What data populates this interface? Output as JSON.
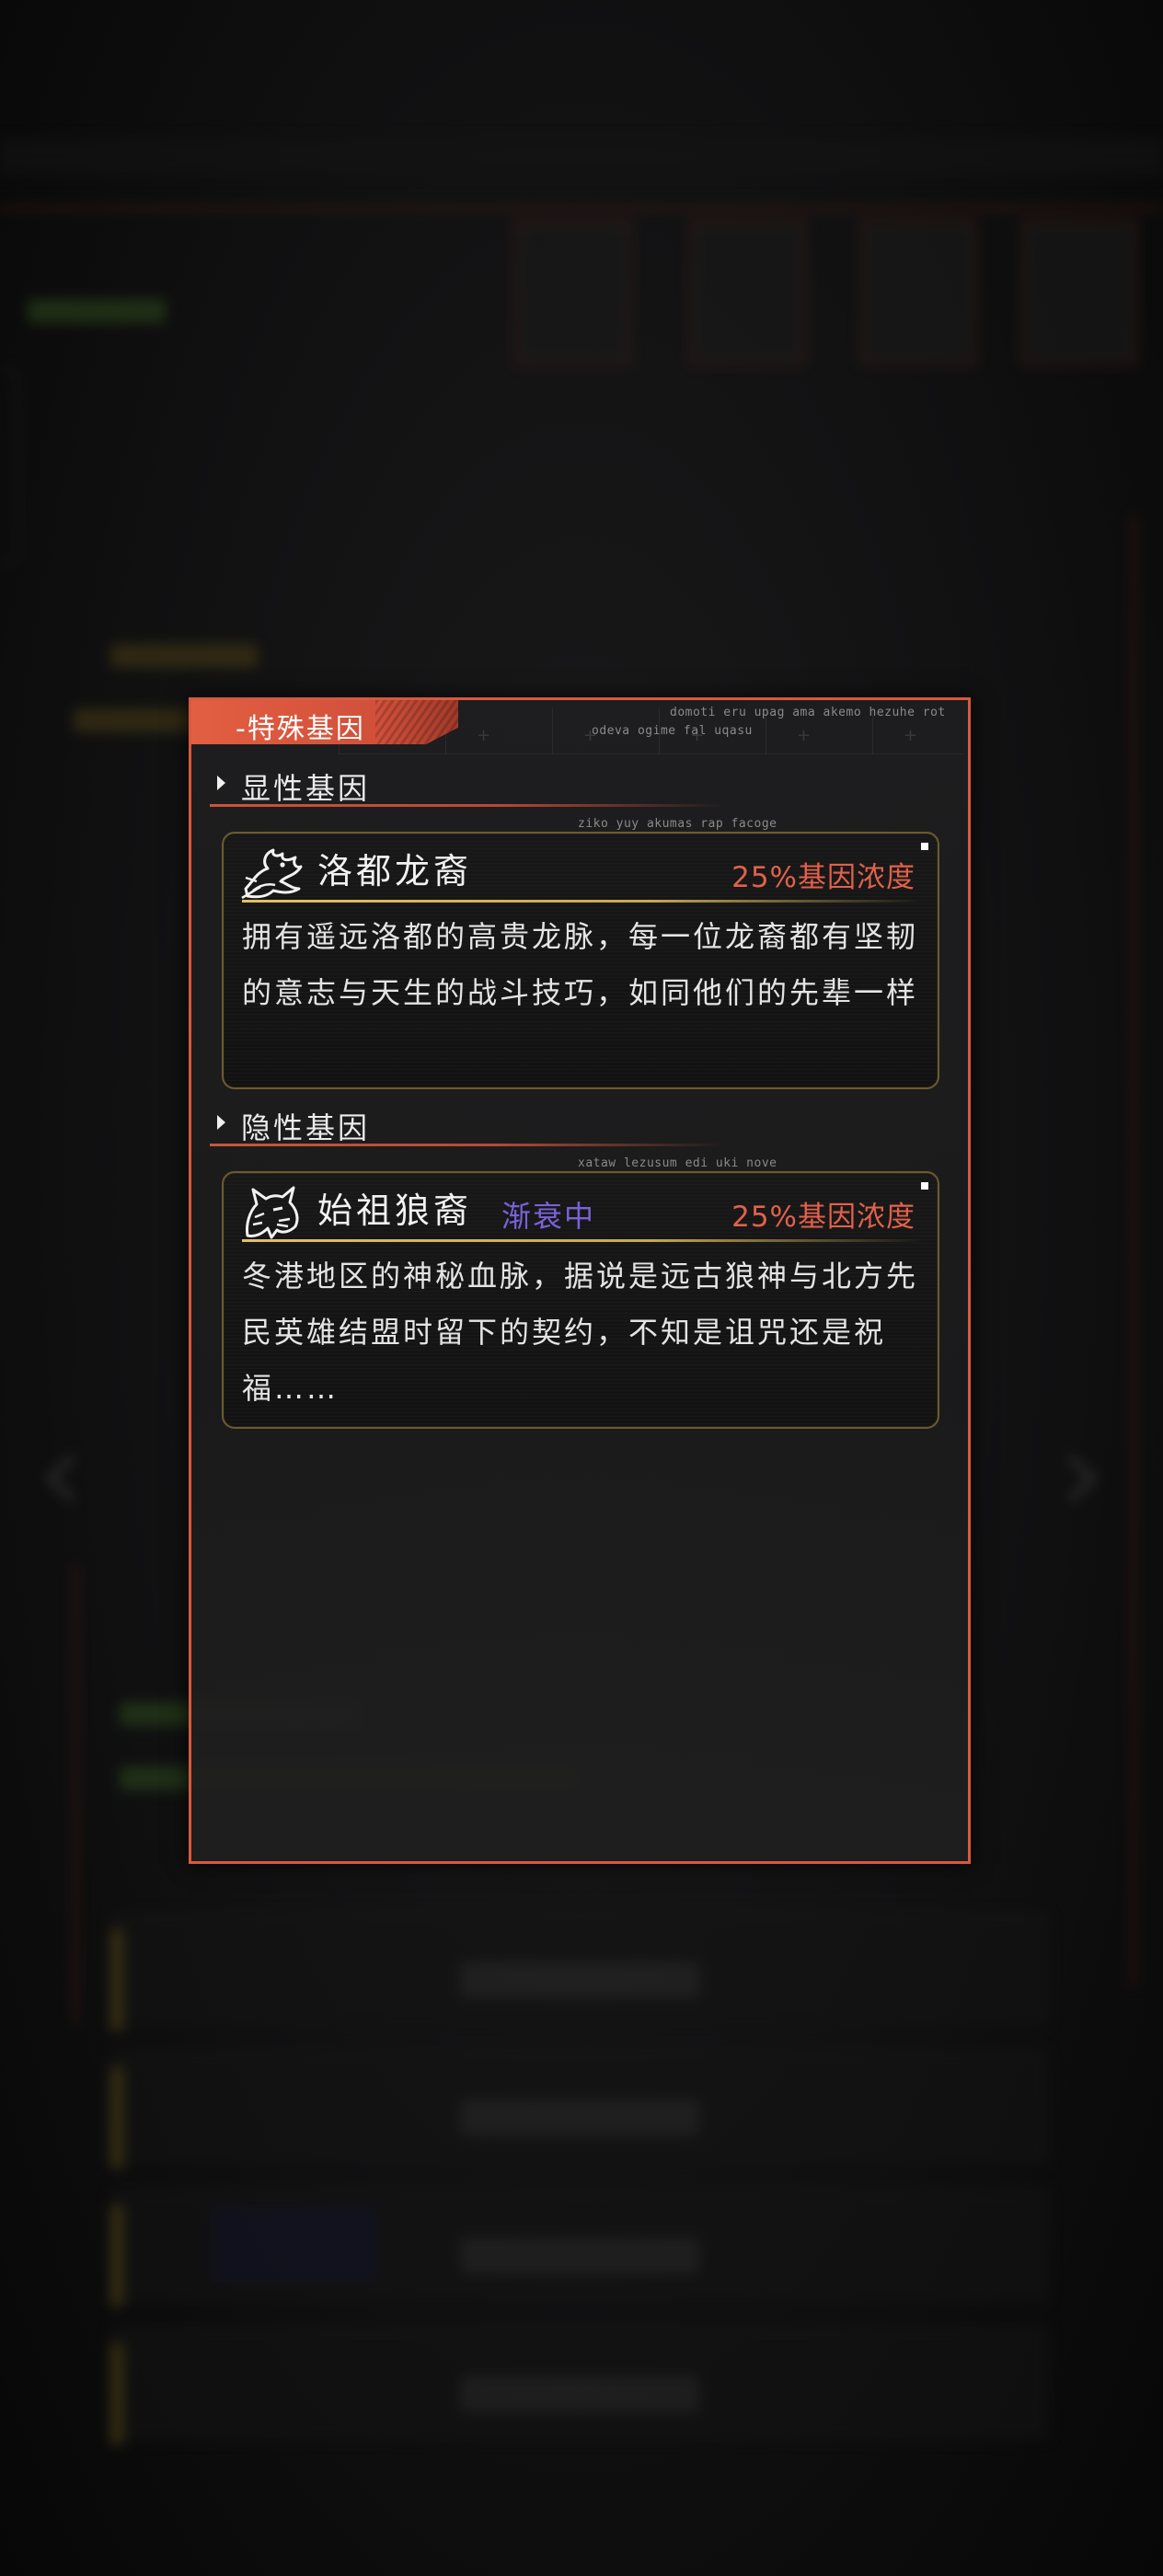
{
  "panel": {
    "title": "-特殊基因",
    "header_deco_1": "domoti eru upag ama akemo hezuhe rot",
    "header_deco_2": "odeva ogime fal uqasu"
  },
  "dominant": {
    "section_label": "显性基因",
    "gene": {
      "icon": "dragon-icon",
      "name": "洛都龙裔",
      "concentration": "25%基因浓度",
      "description": "拥有遥远洛都的高贵龙脉，每一位龙裔都有坚韧的意志与天生的战斗技巧，如同他们的先辈一样",
      "deco": "ziko yuy akumas rap facoge"
    }
  },
  "recessive": {
    "section_label": "隐性基因",
    "gene": {
      "icon": "wolf-icon",
      "name": "始祖狼裔",
      "status": "渐衰中",
      "concentration": "25%基因浓度",
      "description": "冬港地区的神秘血脉，据说是远古狼神与北方先民英雄结盟时留下的契约，不知是诅咒还是祝福……",
      "deco": "xataw lezusum edi uki nove"
    }
  },
  "colors": {
    "accent": "#d8593e",
    "concentration": "#e2614a",
    "status": "#7a62d8",
    "card_border": "#6b5b2e",
    "gold_line": "#e2c062"
  }
}
